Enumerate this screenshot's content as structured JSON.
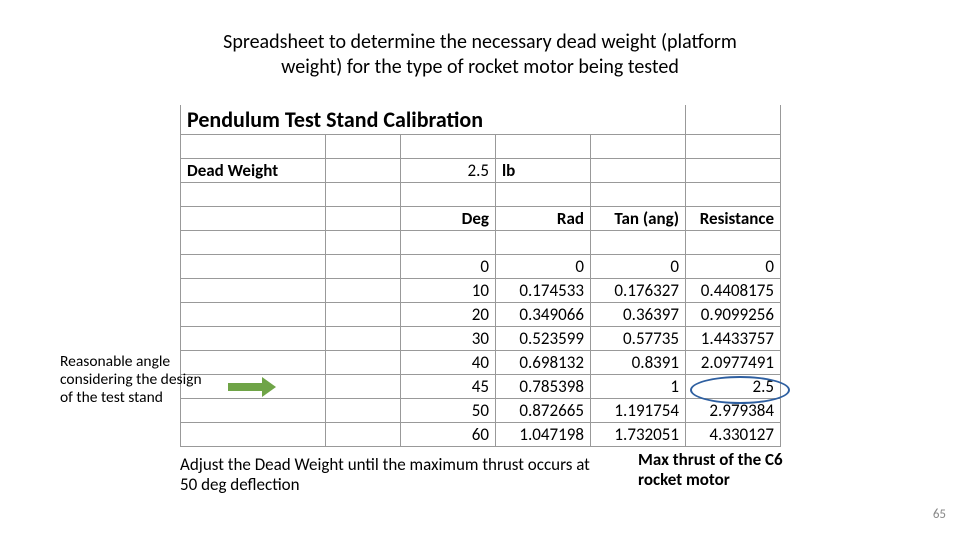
{
  "title_line1": "Spreadsheet to determine the necessary dead weight (platform",
  "title_line2": "weight) for the type of rocket motor being tested",
  "sheet_title": "Pendulum Test Stand Calibration",
  "dead_weight_label": "Dead Weight",
  "dead_weight_value": "2.5",
  "dead_weight_unit": "lb",
  "headers": {
    "deg": "Deg",
    "rad": "Rad",
    "tan": "Tan (ang)",
    "res": "Resistance"
  },
  "rows": [
    {
      "deg": "0",
      "rad": "0",
      "tan": "0",
      "res": "0"
    },
    {
      "deg": "10",
      "rad": "0.174533",
      "tan": "0.176327",
      "res": "0.4408175"
    },
    {
      "deg": "20",
      "rad": "0.349066",
      "tan": "0.36397",
      "res": "0.9099256"
    },
    {
      "deg": "30",
      "rad": "0.523599",
      "tan": "0.57735",
      "res": "1.4433757"
    },
    {
      "deg": "40",
      "rad": "0.698132",
      "tan": "0.8391",
      "res": "2.0977491"
    },
    {
      "deg": "45",
      "rad": "0.785398",
      "tan": "1",
      "res": "2.5"
    },
    {
      "deg": "50",
      "rad": "0.872665",
      "tan": "1.191754",
      "res": "2.979384"
    },
    {
      "deg": "60",
      "rad": "1.047198",
      "tan": "1.732051",
      "res": "4.330127"
    }
  ],
  "annot_left": "Reasonable angle considering the design of the test stand",
  "bottom_left": "Adjust the Dead Weight until the maximum  thrust occurs at 50 deg deflection",
  "bottom_right": "Max thrust of the C6 rocket motor",
  "page_number": "65"
}
